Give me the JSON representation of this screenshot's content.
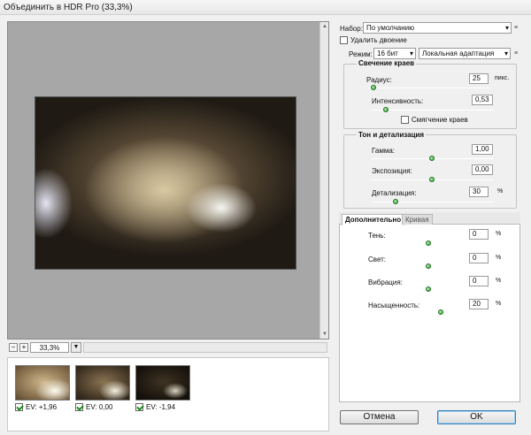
{
  "window": {
    "title": "Объединить в HDR Pro (33,3%)"
  },
  "preview": {
    "zoom_value": "33,3%",
    "zoom_out_label": "−",
    "zoom_in_label": "+"
  },
  "filmstrip": {
    "items": [
      {
        "label": "EV: +1,96",
        "checked": true
      },
      {
        "label": "EV: 0,00",
        "checked": true
      },
      {
        "label": "EV: -1,94",
        "checked": true
      }
    ]
  },
  "settings": {
    "preset_label": "Набор:",
    "preset_value": "По умолчанию",
    "remove_ghosts_label": "Удалить двоение",
    "mode_label": "Режим:",
    "bit_depth_value": "16 бит",
    "method_value": "Локальная адаптация"
  },
  "edge_glow": {
    "title": "Свечение краев",
    "radius_label": "Радиус:",
    "radius_value": "25",
    "radius_unit": "пикс.",
    "radius_fraction": 0.05,
    "strength_label": "Интенсивность:",
    "strength_value": "0,53",
    "strength_fraction": 0.12,
    "smooth_edges_label": "Смягчение краев"
  },
  "tone_detail": {
    "title": "Тон и детализация",
    "gamma_label": "Гамма:",
    "gamma_value": "1,00",
    "gamma_fraction": 0.5,
    "exposure_label": "Экспозиция:",
    "exposure_value": "0,00",
    "exposure_fraction": 0.5,
    "detail_label": "Детализация:",
    "detail_value": "30",
    "detail_unit": "%",
    "detail_fraction": 0.2
  },
  "advanced": {
    "tab_advanced": "Дополнительно",
    "tab_curve": "Кривая",
    "shadow_label": "Тень:",
    "shadow_value": "0",
    "shadow_fraction": 0.5,
    "highlight_label": "Свет:",
    "highlight_value": "0",
    "highlight_fraction": 0.5,
    "vibrance_label": "Вибрация:",
    "vibrance_value": "0",
    "vibrance_fraction": 0.5,
    "saturation_label": "Насыщенность:",
    "saturation_value": "20",
    "saturation_fraction": 0.6,
    "unit": "%"
  },
  "buttons": {
    "cancel": "Отмена",
    "ok": "OK"
  }
}
